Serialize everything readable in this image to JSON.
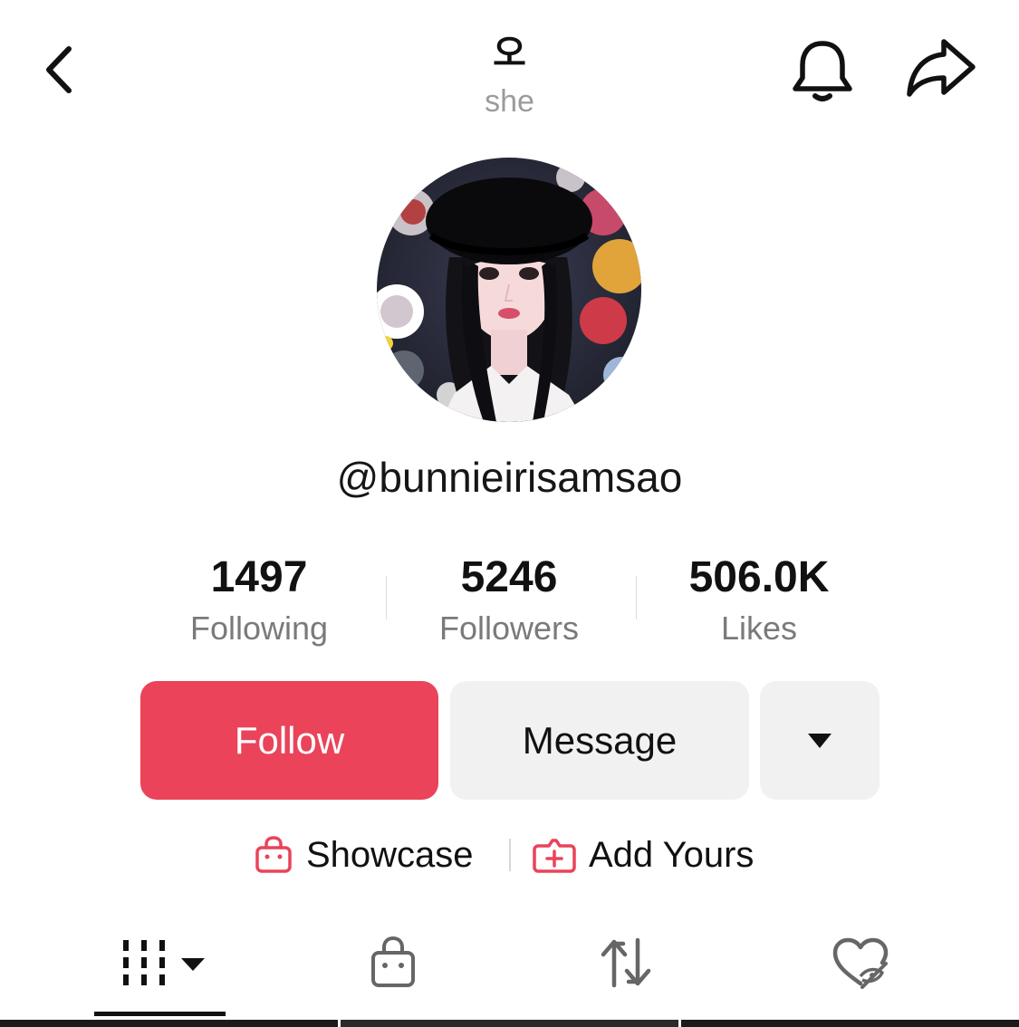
{
  "header": {
    "nickname": "오",
    "pronoun": "she",
    "icons": {
      "back": "chevron-left-icon",
      "notifications": "bell-icon",
      "share": "share-arrow-icon"
    }
  },
  "profile": {
    "username": "@bunnieirisamsao"
  },
  "stats": {
    "following": {
      "value": "1497",
      "label": "Following"
    },
    "followers": {
      "value": "5246",
      "label": "Followers"
    },
    "likes": {
      "value": "506.0K",
      "label": "Likes"
    }
  },
  "actions": {
    "follow_label": "Follow",
    "message_label": "Message",
    "more_icon": "caret-down-icon"
  },
  "links": {
    "showcase_label": "Showcase",
    "add_yours_label": "Add Yours"
  },
  "tabs": [
    {
      "icon": "videos-grid-icon",
      "selected": true
    },
    {
      "icon": "shop-bag-icon",
      "selected": false
    },
    {
      "icon": "repost-icon",
      "selected": false
    },
    {
      "icon": "liked-hidden-icon",
      "selected": false
    }
  ],
  "colors": {
    "accent": "#ea435a",
    "button_secondary": "#f1f1f2",
    "muted_text": "#7a7a7a",
    "pronoun_text": "#9b9b9b"
  }
}
